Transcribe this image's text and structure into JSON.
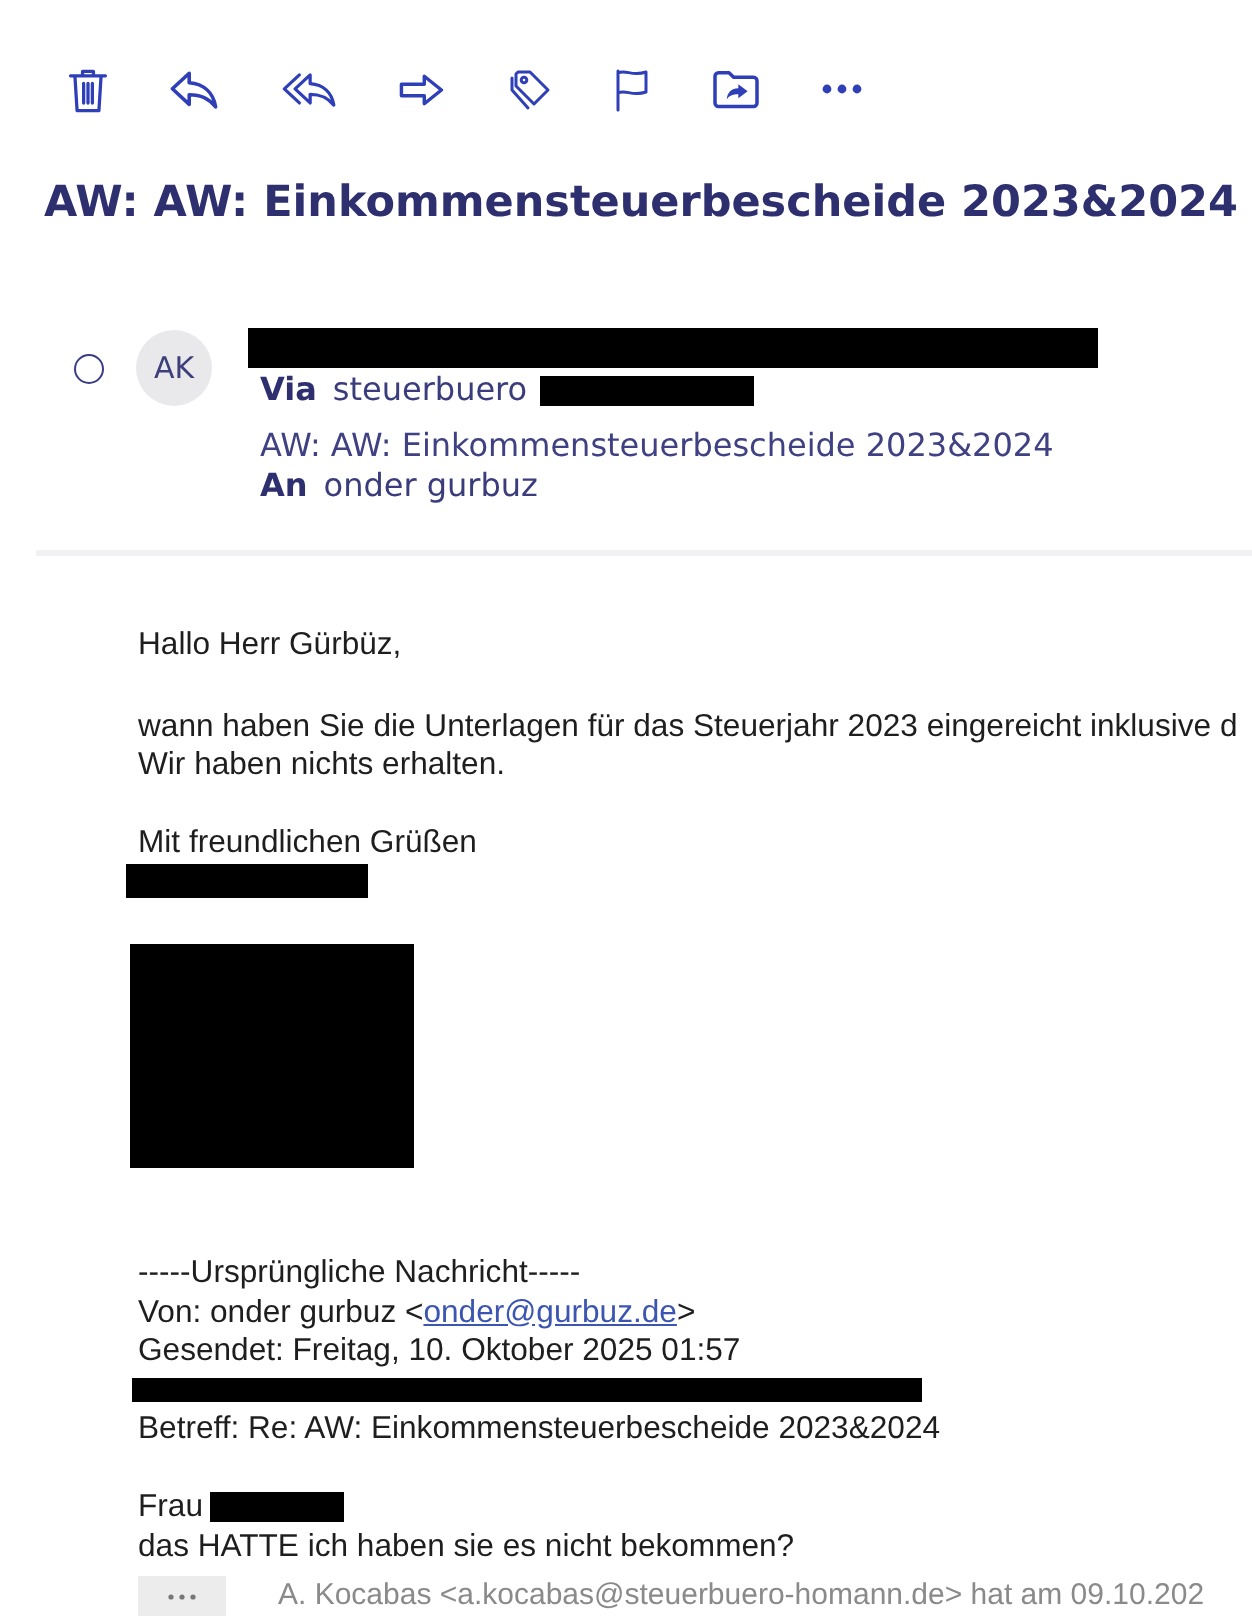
{
  "subject": "AW: AW: Einkommensteuerbescheide 2023&2024",
  "message": {
    "selected": false,
    "avatar": "AK",
    "via_label": "Via",
    "via": "steuerbuero",
    "subject": "AW: AW: Einkommensteuerbescheide 2023&2024",
    "to_label": "An",
    "to": "onder gurbuz"
  },
  "body": {
    "greeting": "Hallo Herr Gürbüz,",
    "paragraph": [
      "wann haben Sie die Unterlagen für das Steuerjahr 2023 eingereicht inklusive d",
      "Wir haben nichts erhalten."
    ],
    "closing": "Mit freundlichen Grüßen"
  },
  "quoted": {
    "separator": "-----Ursprüngliche Nachricht-----",
    "from": {
      "prefix": "Von: onder gurbuz <",
      "email": "onder@gurbuz.de",
      "suffix": ">"
    },
    "sent": "Gesendet: Freitag, 10. Oktober 2025 01:57",
    "subject": "Betreff: Re: AW: Einkommensteuerbescheide 2023&2024",
    "salutation": "Frau",
    "text": "das HATTE ich haben sie es nicht bekommen?"
  },
  "earlier_message": {
    "text": "A. Kocabas <a.kocabas@steuerbuero-homann.de> hat am 09.10.202"
  }
}
